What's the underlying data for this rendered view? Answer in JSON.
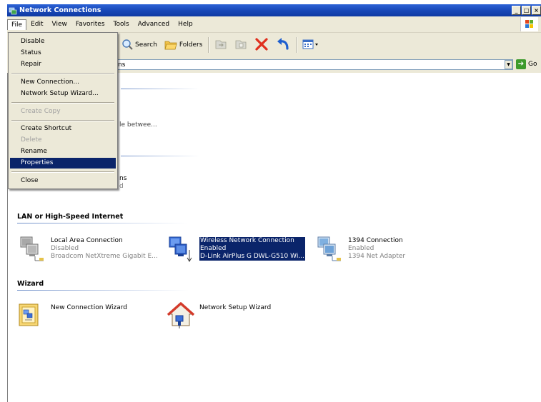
{
  "window": {
    "title": "Network Connections",
    "controls": [
      "_",
      "□",
      "×"
    ]
  },
  "menubar": {
    "items": [
      "File",
      "Edit",
      "View",
      "Favorites",
      "Tools",
      "Advanced",
      "Help"
    ]
  },
  "toolbar": {
    "search_label": "Search",
    "folders_label": "Folders"
  },
  "address": {
    "value": "ns",
    "go_label": "Go"
  },
  "file_menu": {
    "items": [
      {
        "label": "Disable",
        "enabled": true
      },
      {
        "label": "Status",
        "enabled": true
      },
      {
        "label": "Repair",
        "enabled": true
      },
      {
        "label": "New Connection...",
        "enabled": true
      },
      {
        "label": "Network Setup Wizard...",
        "enabled": true
      },
      {
        "label": "Create Copy",
        "enabled": false
      },
      {
        "label": "Create Shortcut",
        "enabled": true
      },
      {
        "label": "Delete",
        "enabled": false
      },
      {
        "label": "Rename",
        "enabled": true
      },
      {
        "label": "Properties",
        "enabled": true,
        "highlighted": true
      },
      {
        "label": "Close",
        "enabled": true
      }
    ]
  },
  "partial_text": {
    "between": "le betwee...",
    "ns": "ns",
    "d": "d"
  },
  "groups": {
    "lan": "LAN or High-Speed Internet",
    "wizard": "Wizard"
  },
  "connections": [
    {
      "name": "Local Area Connection",
      "status": "Disabled",
      "device": "Broadcom NetXtreme Gigabit E..."
    },
    {
      "name": "Wireless Network Connection",
      "status": "Enabled",
      "device": "D-Link AirPlus G DWL-G510 Wi...",
      "selected": true
    },
    {
      "name": "1394 Connection",
      "status": "Enabled",
      "device": "1394 Net Adapter"
    }
  ],
  "wizards": [
    {
      "name": "New Connection Wizard"
    },
    {
      "name": "Network Setup Wizard"
    }
  ]
}
